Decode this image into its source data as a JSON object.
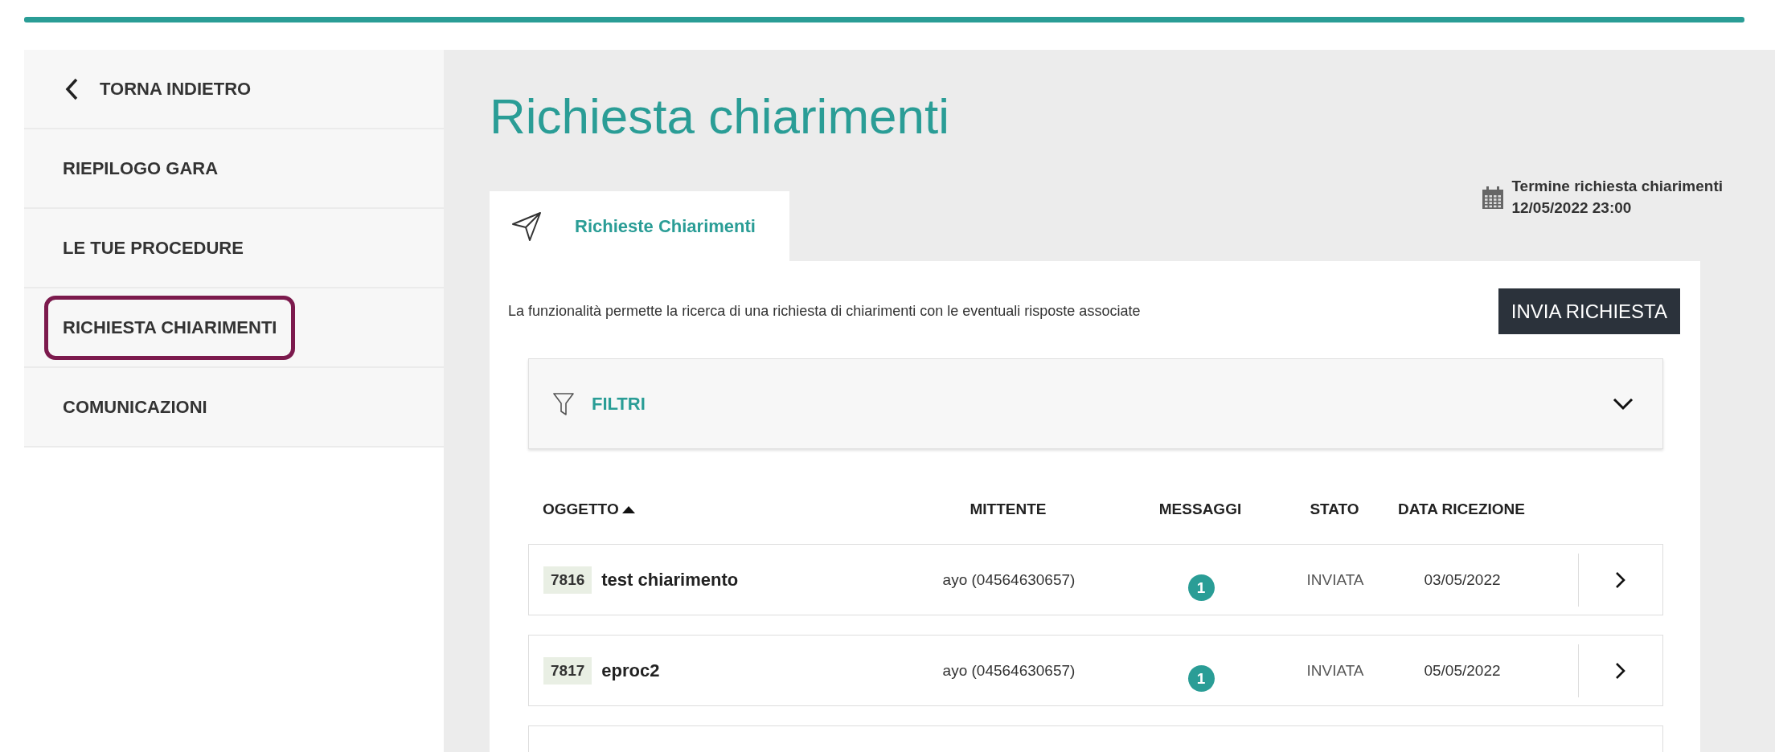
{
  "nav": {
    "back": {
      "label": "TORNA INDIETRO"
    },
    "items": [
      {
        "label": "RIEPILOGO GARA",
        "selected": false
      },
      {
        "label": "LE TUE PROCEDURE",
        "selected": false
      },
      {
        "label": "RICHIESTA CHIARIMENTI",
        "selected": true
      },
      {
        "label": "COMUNICAZIONI",
        "selected": false
      }
    ]
  },
  "page": {
    "title": "Richiesta chiarimenti"
  },
  "tabs": [
    {
      "label": "Richieste Chiarimenti",
      "selected": true
    }
  ],
  "deadline": {
    "label": "Termine richiesta chiarimenti",
    "value": "12/05/2022 23:00"
  },
  "description": "La funzionalità permette la ricerca di una richiesta di chiarimenti con le eventuali risposte associate",
  "buttons": {
    "send": "INVIA RICHIESTA"
  },
  "filters": {
    "label": "FILTRI",
    "expanded": false
  },
  "table": {
    "columns": [
      {
        "label": "OGGETTO",
        "sorted": true
      },
      {
        "label": "MITTENTE",
        "sorted": false
      },
      {
        "label": "MESSAGGI",
        "sorted": false
      },
      {
        "label": "STATO",
        "sorted": false
      },
      {
        "label": "DATA RICEZIONE",
        "sorted": false
      }
    ],
    "rows": [
      {
        "id": "7816",
        "subject": "test chiarimento",
        "sender": "ayo (04564630657)",
        "messages": "1",
        "status": "INVIATA",
        "date": "03/05/2022"
      },
      {
        "id": "7817",
        "subject": "eproc2",
        "sender": "ayo (04564630657)",
        "messages": "1",
        "status": "INVIATA",
        "date": "05/05/2022"
      }
    ]
  }
}
